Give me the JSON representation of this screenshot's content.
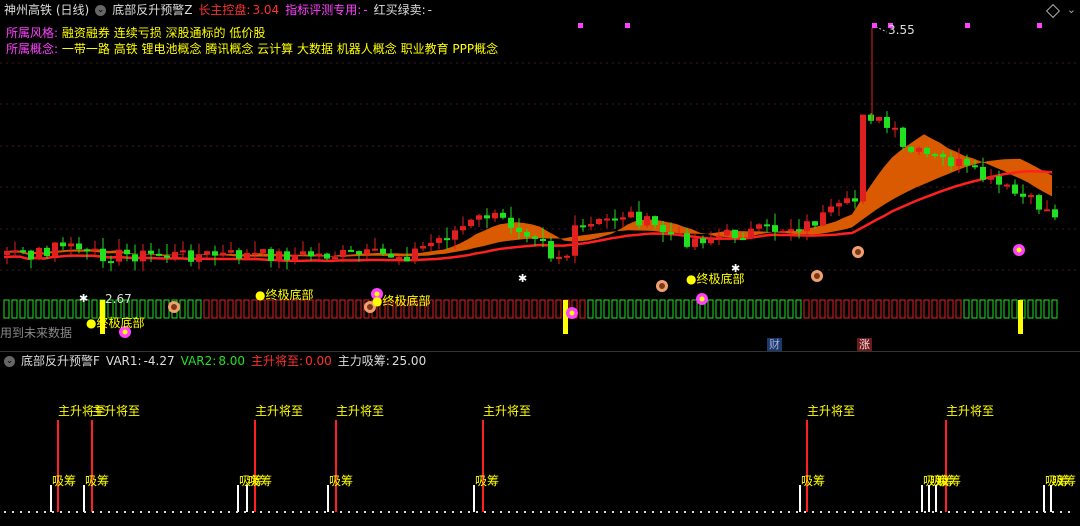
{
  "header": {
    "stock_title": "神州高铁 (日线)",
    "indicator_name": "底部反升预警Z",
    "main_control_label": "长主控盘:",
    "main_control_value": "3.04",
    "eval_label": "指标评测专用:",
    "eval_value": "-",
    "buy_sell_label": "红买绿卖:",
    "buy_sell_value": "-"
  },
  "info": {
    "style_label": "所属风格:",
    "style_value": "融资融券 连续亏损 深股通标的 低价股",
    "concept_label": "所属概念:",
    "concept_value": "一带一路 高铁 锂电池概念 腾讯概念 云计算 大数据 机器人概念 职业教育 PPP概念"
  },
  "annotations": {
    "high": "3.55",
    "low": "2.67",
    "bottom_signal": "终极底部",
    "future_data": "用到未来数据",
    "badge_fin": "财",
    "badge_up": "涨"
  },
  "sub_header": {
    "indicator_name": "底部反升预警F",
    "var1_label": "VAR1:",
    "var1_value": "-4.27",
    "var2_label": "VAR2:",
    "var2_value": "8.00",
    "rise_label": "主升将至:",
    "rise_value": "0.00",
    "absorb_label": "主力吸筹:",
    "absorb_value": "25.00"
  },
  "sub_labels": {
    "rise": "主升将至",
    "absorb": "吸筹"
  },
  "colors": {
    "up": "#e02020",
    "down": "#20e020",
    "magenta": "#ff40ff",
    "yellow": "#ffff00",
    "orange": "#ff6a00",
    "ma_red": "#ff2020",
    "label_magenta": "#ff40ff",
    "label_red": "#ff3030"
  },
  "icons": {
    "collapse": "chevron-down-icon",
    "expand": "diamond-icon"
  }
}
